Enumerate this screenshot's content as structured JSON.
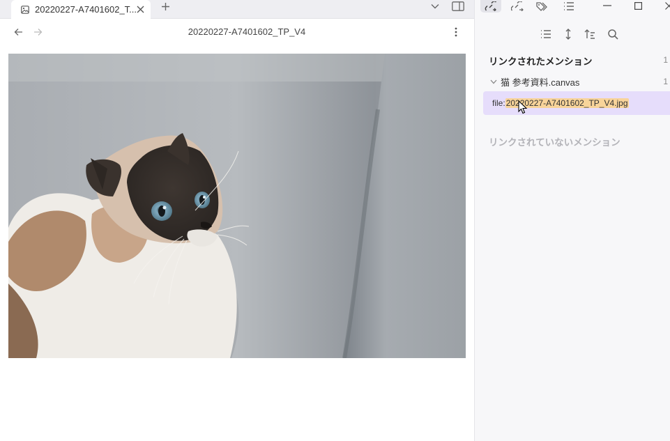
{
  "tab": {
    "title": "20220227-A7401602_T...",
    "icon": "image-file-icon"
  },
  "nav": {
    "title": "20220227-A7401602_TP_V4"
  },
  "image": {
    "subject": "Siamese-pattern cat on a grey sofa, looking up",
    "colors": {
      "sofa": "#9fa4aa",
      "fur_white": "#f4f2ee",
      "fur_brown": "#7a5a44",
      "eyes": "#8fb6cc"
    }
  },
  "backlinks": {
    "linked_header": "リンクされたメンション",
    "linked_count": "1",
    "file_name": "猫 参考資料.canvas",
    "file_count": "1",
    "match_prefix": "file: ",
    "match_highlight": "20220227-A7401602_TP_V4.jpg",
    "unlinked_header": "リンクされていないメンション"
  },
  "colors": {
    "accent": "#e6ddfb",
    "highlight": "#f8d49a"
  }
}
